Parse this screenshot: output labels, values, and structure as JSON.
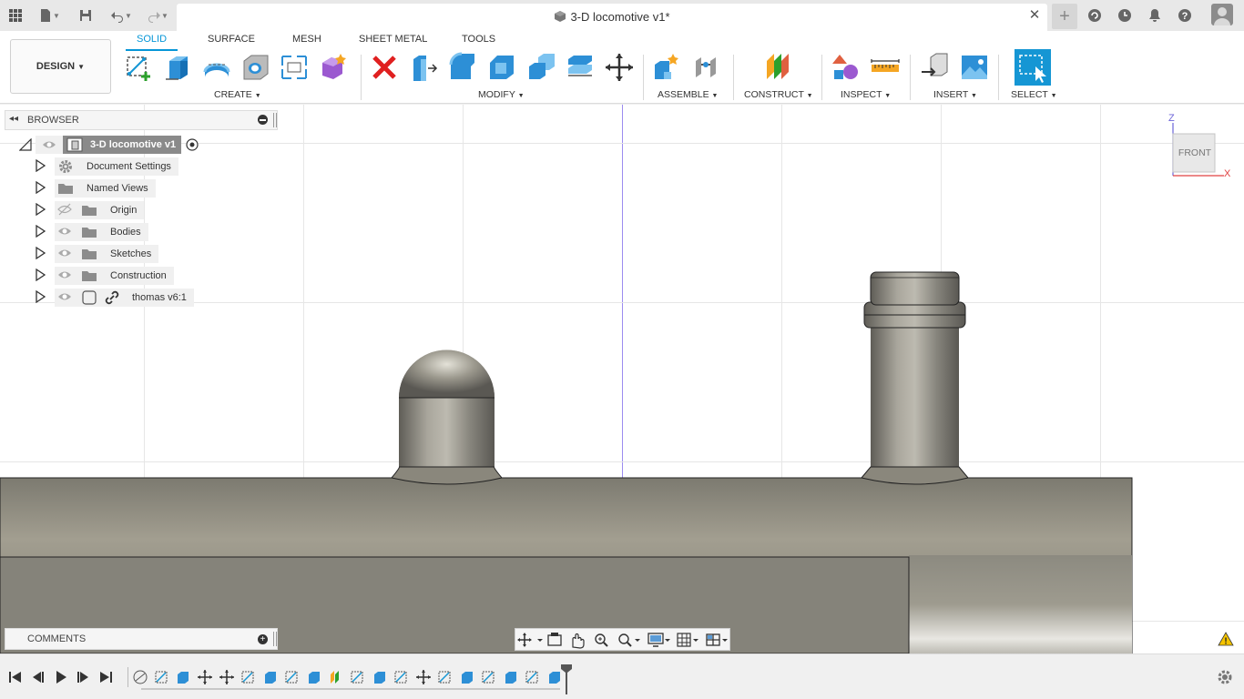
{
  "window": {
    "doc_title": "3-D locomotive v1*"
  },
  "ribbon": {
    "workspace": "DESIGN",
    "tabs": [
      "SOLID",
      "SURFACE",
      "MESH",
      "SHEET METAL",
      "TOOLS"
    ],
    "groups": {
      "create": "CREATE",
      "modify": "MODIFY",
      "assemble": "ASSEMBLE",
      "construct": "CONSTRUCT",
      "inspect": "INSPECT",
      "insert": "INSERT",
      "select": "SELECT"
    }
  },
  "browser": {
    "title": "BROWSER",
    "root": "3-D locomotive v1",
    "items": [
      {
        "label": "Document Settings",
        "icon": "gear-icon",
        "visible": null
      },
      {
        "label": "Named Views",
        "icon": "folder-icon",
        "visible": null
      },
      {
        "label": "Origin",
        "icon": "folder-icon",
        "visible": false
      },
      {
        "label": "Bodies",
        "icon": "folder-icon",
        "visible": true
      },
      {
        "label": "Sketches",
        "icon": "folder-icon",
        "visible": true
      },
      {
        "label": "Construction",
        "icon": "folder-icon",
        "visible": true
      },
      {
        "label": "thomas v6:1",
        "icon": "component-link-icon",
        "visible": true
      }
    ]
  },
  "comments": {
    "title": "COMMENTS"
  },
  "viewcube": {
    "face": "FRONT",
    "axis_z": "Z",
    "axis_x": "X"
  },
  "colors": {
    "accent": "#0696d7",
    "metal": "#8c8a80",
    "select": "#1596d4"
  }
}
